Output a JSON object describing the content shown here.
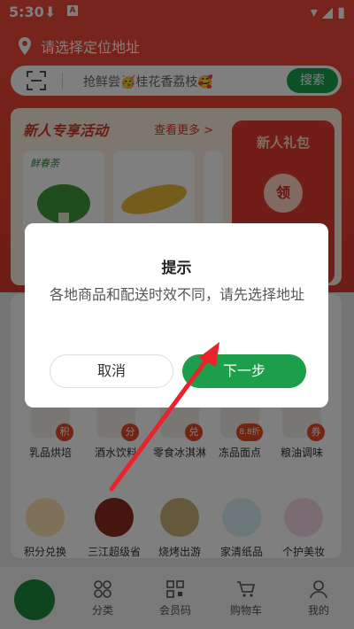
{
  "status_bar": {
    "time": "5:30",
    "download_icon": "download-icon",
    "a_icon_label": "A"
  },
  "location": {
    "label": "请选择定位地址"
  },
  "search": {
    "placeholder": "抢鲜尝🥳桂花香荔枝🥰",
    "button": "搜索"
  },
  "promo": {
    "title": "新人专享活动",
    "more": "查看更多 >",
    "product_tag": "鲜春荼",
    "gift_title": "新人礼包",
    "gift_badge": "领"
  },
  "categories_row1": [
    {
      "label": "乳品烘培",
      "badge": "积"
    },
    {
      "label": "酒水饮料",
      "badge": "分"
    },
    {
      "label": "零食冰淇淋",
      "badge": "兑"
    },
    {
      "label": "冻品面点",
      "badge": "8.8折"
    },
    {
      "label": "粮油调味",
      "badge": "券"
    }
  ],
  "categories_row2": [
    {
      "label": "积分兑换"
    },
    {
      "label": "三江超级省"
    },
    {
      "label": "烧烤出游"
    },
    {
      "label": "家清纸品"
    },
    {
      "label": "个护美妆"
    }
  ],
  "tabbar": {
    "tab1": "分类",
    "tab2": "会员码",
    "tab3": "购物车",
    "tab4": "我的"
  },
  "dialog": {
    "title": "提示",
    "message": "各地商品和配送时效不同，请先选择地址",
    "cancel": "取消",
    "next": "下一步"
  },
  "colors": {
    "brand_red": "#e9412f",
    "accent_green": "#1c9e4a"
  }
}
